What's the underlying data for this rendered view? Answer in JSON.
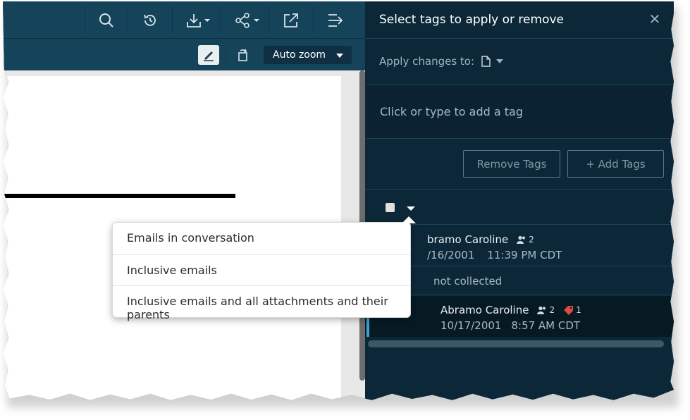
{
  "toolbar": {
    "icons": [
      "search-icon",
      "history-icon",
      "download-icon",
      "share-icon",
      "external-link-icon",
      "collapse-panel-icon"
    ]
  },
  "subbar": {
    "zoom_value": "Auto zoom",
    "icons": [
      "highlight-icon",
      "rotate-icon"
    ]
  },
  "panel": {
    "title": "Select tags to apply or remove",
    "apply_label": "Apply changes to:",
    "tag_placeholder": "Click or type to add a tag",
    "remove_button": "Remove Tags",
    "add_button": "+ Add Tags",
    "rows": [
      {
        "name": "bramo Caroline",
        "people": "2",
        "date": "/16/2001",
        "time": "11:39 PM CDT"
      },
      {
        "status": "not collected"
      },
      {
        "name": "Abramo Caroline",
        "people": "2",
        "tags": "1",
        "date": "10/17/2001",
        "time": "8:57 AM CDT"
      }
    ]
  },
  "popup": {
    "items": [
      "Emails in conversation",
      "Inclusive emails",
      "Inclusive emails and all attachments and their parents"
    ]
  },
  "colors": {
    "toolbar_bg": "#15435a",
    "panel_bg": "#0c2838",
    "accent": "#3aa0d8",
    "tag_red": "#e04a3c"
  }
}
